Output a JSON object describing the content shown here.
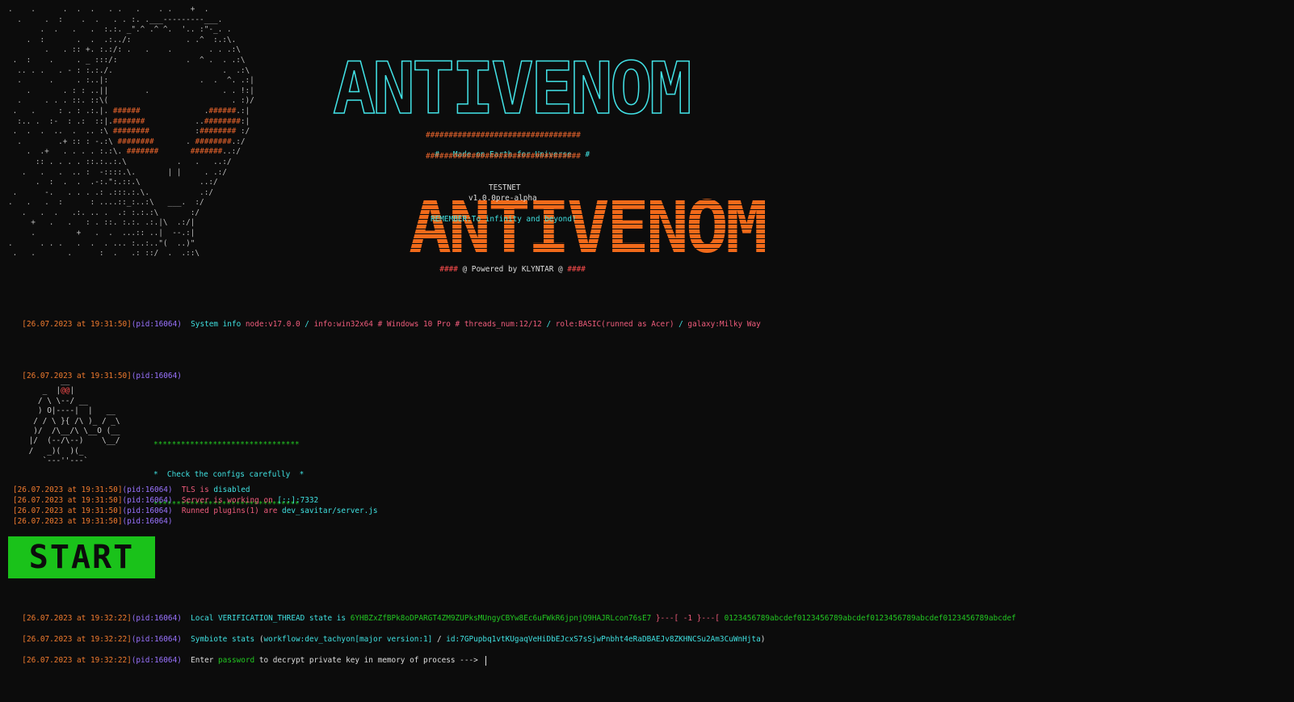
{
  "logo": "ANTIVENOM",
  "banner": {
    "hashes": "##################################",
    "tagline": "#   Made on Earth for Universe   #",
    "network": "TESTNET",
    "version": "v1.0.0pre-alpha",
    "remember": "REMEMBER:To infinity and beyond!",
    "powered_left": "####",
    "powered_text": " @ Powered by KLYNTAR @ ",
    "powered_right": "####"
  },
  "ascii_art": [
    ".    .      .  .  .   . .   .    . .    +  .",
    "  .     .  :    .  .   . . :. .___---------___.",
    "       .  .   .   .  :.:. _\".^ .^ ^.  '.. :\"-_. .",
    "    .  :       .  .  .:../:            . .^  :.:\\.",
    "        .   . :: +. :.:/: .   .    .        . . .:\\",
    " .  :    .     . _ :::/:               .  ^ .  . .:\\",
    "  .. . .   . - : :.:./.                        .  .:\\",
    "  .      .     . :..|:                    .  .  ^. .:|",
    "    .       . : : ..||        .                . . !:|",
    "  .     . . . ::. ::\\(                           . :)/",
    " .   .     : . : .:.|. ######              .######.:|",
    "  :.. .  :-  : .:  ::|.#######           ..########:|",
    " .  .  .  ..  .  .. :\\ ########          :######## :/",
    "  .        .+ :: : -.:\\ ########       . ########.:/",
    "    .  .+   . . . . :.:\\. #######       #######..:/",
    "      :: . . . . ::.:..:.\\           .   .   ..:/",
    "   .   .   .  .. :  -::::.\\.       | |     . .:/",
    "      .  :  .  .  .-:.\":.::.\\             ..:/",
    " .      -.   . . . .: .:::.:.\\.           .:/",
    ".   .   .  :      : ....::_:..:\\   ___.  :/",
    "   .   .  .   .:. .. .  .: :.:.:\\       :/",
    "     +   .   .   : . ::. :.:. .:.|\\  .:/|",
    "     .         +   .  .  ...:: ..|  --.:|",
    ".      . . .   .  .  . ... :..:..\"(  ..)\"",
    " .   .       .      :  .   .: ::/  .  .::\\"
  ],
  "system_info": {
    "timestamp": "[26.07.2023 at 19:31:50]",
    "pid": "(pid:16064)",
    "label": "System info",
    "node": "node:v17.0.0",
    "sep1": " / ",
    "info": "info:win32x64 # Windows 10 Pro # threads_num:12/12",
    "sep2": " / ",
    "role": "role:BASIC(runned as Acer)",
    "sep3": " / ",
    "galaxy": "galaxy:Milky Way"
  },
  "empty_line": {
    "timestamp": "[26.07.2023 at 19:31:50]",
    "pid": "(pid:16064)"
  },
  "robot": [
    "        __",
    "    _  |@@|",
    "   / \\ \\--/ __",
    "   ) O|----|  |   __",
    "  / / \\ }{ /\\ )_ / _\\",
    "  )/  /\\__/\\ \\__O (__",
    " |/  (--/\\--)    \\__/",
    " /   _)(  )(_",
    "    `---''---`"
  ],
  "config_box": {
    "stars": "********************************",
    "text": "*  Check the configs carefully  *"
  },
  "logs": [
    {
      "timestamp": "[26.07.2023 at 19:31:50]",
      "pid": "(pid:16064)",
      "a": "TLS is ",
      "b": "disabled",
      "c": ""
    },
    {
      "timestamp": "[26.07.2023 at 19:31:50]",
      "pid": "(pid:16064)",
      "a": "Server is working on ",
      "b": "[::]:7332",
      "c": ""
    },
    {
      "timestamp": "[26.07.2023 at 19:31:50]",
      "pid": "(pid:16064)",
      "a": "Runned plugins(1) are ",
      "b": "dev_savitar/server.js",
      "c": ""
    },
    {
      "timestamp": "[26.07.2023 at 19:31:50]",
      "pid": "(pid:16064)",
      "a": "",
      "b": "",
      "c": ""
    }
  ],
  "start_label": "START",
  "verification": {
    "timestamp": "[26.07.2023 at 19:32:22]",
    "pid": "(pid:16064)",
    "label": "Local VERIFICATION_THREAD state is ",
    "hash": "6YHBZxZfBPk8oDPARGT4ZM9ZUPksMUngyCBYw8Ec6uFWkR6jpnjQ9HAJRLcon76sE7",
    "sep1": " }---[ ",
    "index": "-1",
    "sep2": " }---[ ",
    "value": "0123456789abcdef0123456789abcdef0123456789abcdef0123456789abcdef"
  },
  "symbiote": {
    "timestamp": "[26.07.2023 at 19:32:22]",
    "pid": "(pid:16064)",
    "label": "Symbiote stats ",
    "open": "(",
    "workflow": "workflow:dev_tachyon[major version:1]",
    "sep": " / ",
    "id": "id:7GPupbq1vtKUgaqVeHiDbEJcxS7sSjwPnbht4eRaDBAEJv8ZKHNCSu2Am3CuWnHjta",
    "close": ")"
  },
  "prompt": {
    "timestamp": "[26.07.2023 at 19:32:22]",
    "pid": "(pid:16064)",
    "pre": "Enter ",
    "word": "password",
    "post": " to decrypt private key in memory of process ---> "
  }
}
